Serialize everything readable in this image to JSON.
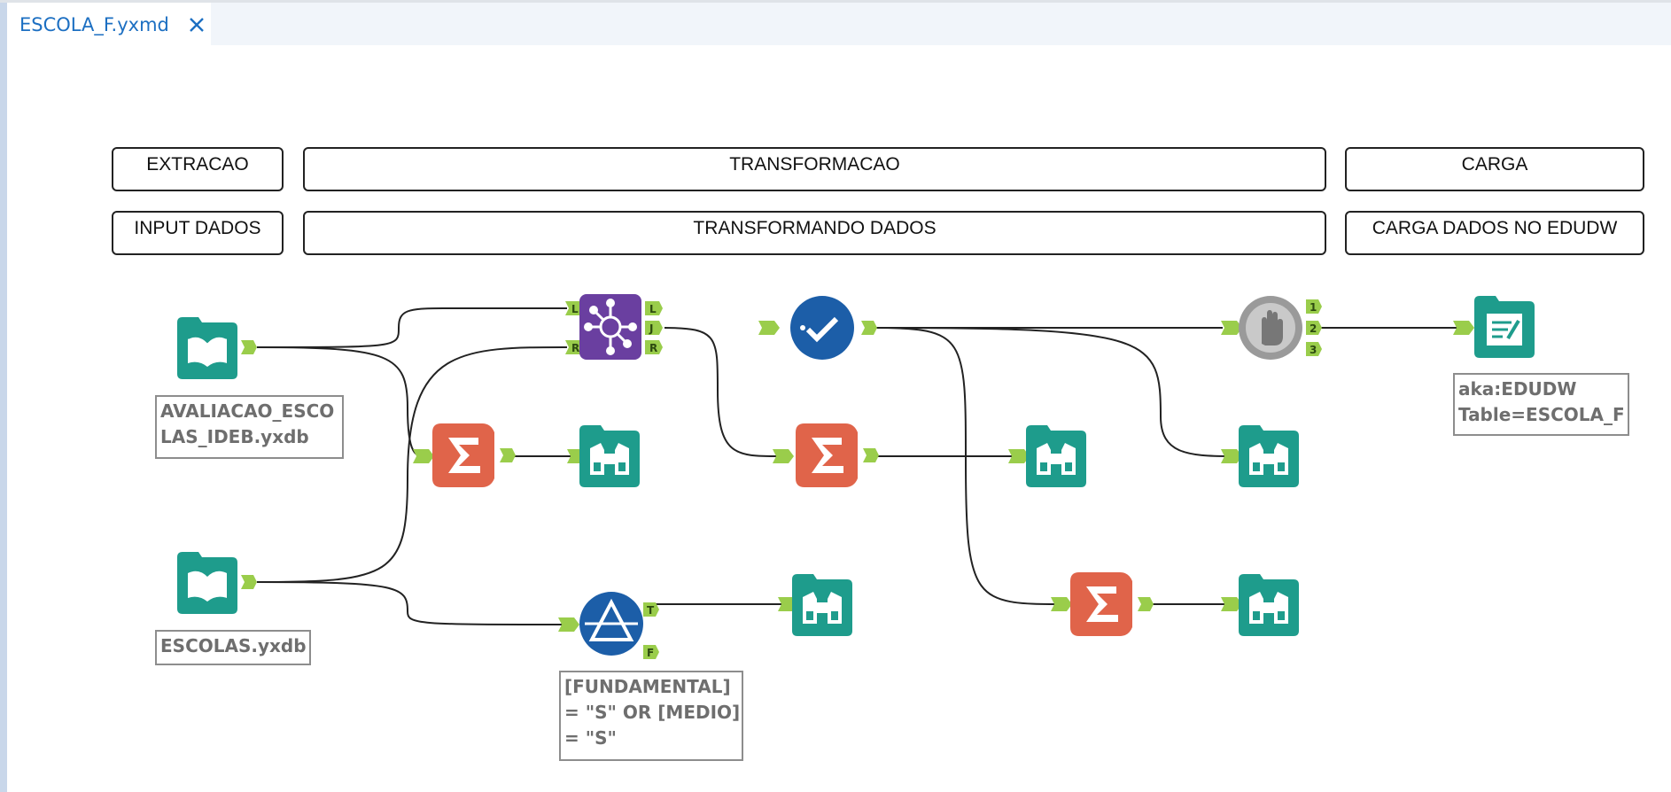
{
  "tab": {
    "title": "ESCOLA_F.yxmd"
  },
  "containers": {
    "extracao": "EXTRACAO",
    "transformacao": "TRANSFORMACAO",
    "carga": "CARGA",
    "input_dados": "INPUT DADOS",
    "transformando_dados": "TRANSFORMANDO DADOS",
    "carga_dados": "CARGA DADOS NO EDUDW"
  },
  "annotations": {
    "input1": "AVALIACAO_ESCO\nLAS_IDEB.yxdb",
    "input2": "ESCOLAS.yxdb",
    "filter": "[FUNDAMENTAL]\n= \"S\" OR [MEDIO]\n= \"S\"",
    "output": "aka:EDUDW\nTable=ESCOLA_F"
  },
  "anchors": {
    "join_L_in": "L",
    "join_R_in": "R",
    "join_L_out": "L",
    "join_J_out": "J",
    "join_R_out": "R",
    "filter_T": "T",
    "filter_F": "F",
    "block_1": "1",
    "block_2": "2",
    "block_3": "3"
  },
  "colors": {
    "input": "#1e9c8c",
    "browse": "#1e9c8c",
    "summarize": "#e0644a",
    "join": "#6a3fa0",
    "filter": "#1c5ea8",
    "select": "#1c5ea8",
    "block": "#9a9a9a",
    "anchor": "#9acd4b"
  },
  "icons": {
    "input": "book-icon",
    "output": "output-file-icon",
    "browse": "binoculars-icon",
    "summarize": "sigma-icon",
    "join": "join-icon",
    "filter": "filter-icon",
    "select": "checkmark-icon",
    "block": "hand-stop-icon"
  }
}
